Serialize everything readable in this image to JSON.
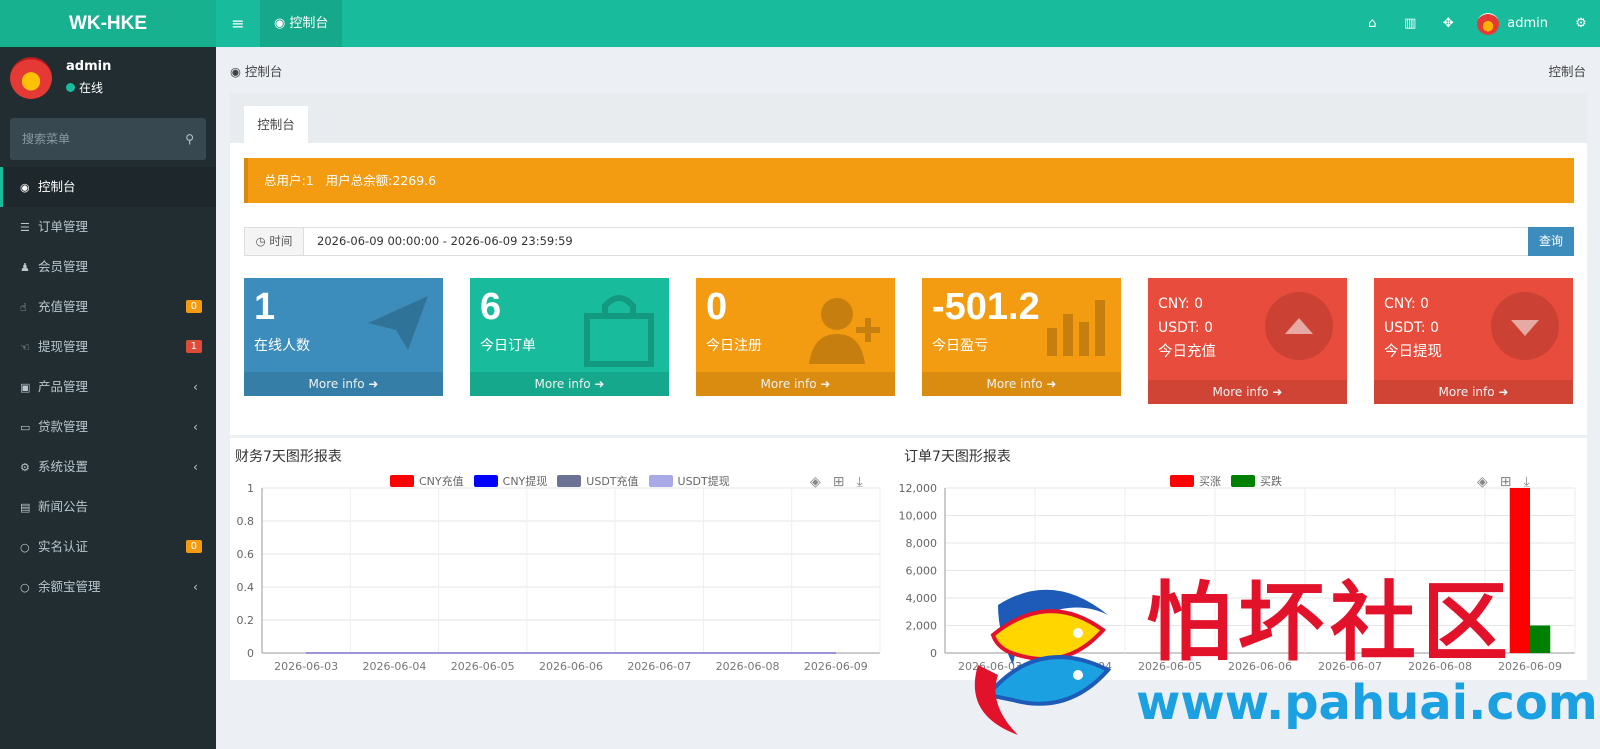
{
  "app": {
    "logo": "WK-HKE"
  },
  "topbar": {
    "menu_icon": "≡",
    "tab_icon": "gauge-icon",
    "tab_label": "控制台",
    "home_icon": "home-icon",
    "trash_icon": "trash-icon",
    "fullscreen_icon": "expand-icon",
    "user_name": "admin",
    "settings_icon": "cogs-icon"
  },
  "sidebar": {
    "user_name": "admin",
    "status": "在线",
    "search_placeholder": "搜索菜单",
    "items": [
      {
        "label": "控制台",
        "icon": "gauge-icon",
        "glyph": "◉",
        "active": true
      },
      {
        "label": "订单管理",
        "icon": "list-icon",
        "glyph": "☰"
      },
      {
        "label": "会员管理",
        "icon": "users-icon",
        "glyph": "♟"
      },
      {
        "label": "充值管理",
        "icon": "hand-icon",
        "glyph": "☝",
        "badge": "0",
        "badge_color": "#f39c12"
      },
      {
        "label": "提现管理",
        "icon": "hand-left-icon",
        "glyph": "☜",
        "badge": "1",
        "badge_color": "#dd4b39"
      },
      {
        "label": "产品管理",
        "icon": "briefcase-icon",
        "glyph": "▣",
        "chevron": "‹"
      },
      {
        "label": "贷款管理",
        "icon": "credit-card-icon",
        "glyph": "▭",
        "chevron": "‹"
      },
      {
        "label": "系统设置",
        "icon": "cogs-icon",
        "glyph": "⚙",
        "chevron": "‹"
      },
      {
        "label": "新闻公告",
        "icon": "newspaper-icon",
        "glyph": "▤"
      },
      {
        "label": "实名认证",
        "icon": "circle-icon",
        "glyph": "○",
        "badge": "0",
        "badge_color": "#f39c12"
      },
      {
        "label": "余额宝管理",
        "icon": "circle-icon",
        "glyph": "○",
        "chevron": "‹"
      }
    ]
  },
  "breadcrumb": {
    "left": "控制台",
    "right": "控制台"
  },
  "content": {
    "tab": "控制台",
    "alert": {
      "users": "总用户:1",
      "balance": "用户总余额:2269.6"
    },
    "time_filter": {
      "label": "时间",
      "value": "2026-06-09 00:00:00 - 2026-06-09 23:59:59",
      "button": "查询"
    },
    "stats": [
      {
        "value": "1",
        "label": "在线人数",
        "footer": "More info ➜",
        "color": "#3c8dbc",
        "icon": "paper-plane-icon"
      },
      {
        "value": "6",
        "label": "今日订单",
        "footer": "More info ➜",
        "color": "#18bc9c",
        "icon": "shopping-bag-icon"
      },
      {
        "value": "0",
        "label": "今日注册",
        "footer": "More info ➜",
        "color": "#f39c12",
        "icon": "user-plus-icon"
      },
      {
        "value": "-501.2",
        "label": "今日盈亏",
        "footer": "More info ➜",
        "color": "#f39c12",
        "icon": "bar-chart-icon"
      },
      {
        "line1": "CNY:  0",
        "line2": "USDT:  0",
        "label": "今日充值",
        "footer": "More info ➜",
        "color": "#e74c3c",
        "icon": "arrow-up-circle-icon"
      },
      {
        "line1": "CNY:  0",
        "line2": "USDT:  0",
        "label": "今日提现",
        "footer": "More info ➜",
        "color": "#e74c3c",
        "icon": "arrow-down-circle-icon"
      }
    ]
  },
  "watermark": {
    "text": "怕坏社区",
    "url": "www.pahuai.com"
  },
  "chart_data": [
    {
      "type": "line",
      "title": "财务7天图形报表",
      "categories": [
        "2026-06-03",
        "2026-06-04",
        "2026-06-05",
        "2026-06-06",
        "2026-06-07",
        "2026-06-08",
        "2026-06-09"
      ],
      "series": [
        {
          "name": "CNY充值",
          "color": "#ff0000",
          "values": [
            0,
            0,
            0,
            0,
            0,
            0,
            0
          ]
        },
        {
          "name": "CNY提现",
          "color": "#0000ff",
          "values": [
            0,
            0,
            0,
            0,
            0,
            0,
            0
          ]
        },
        {
          "name": "USDT充值",
          "color": "#6c7294",
          "values": [
            0,
            0,
            0,
            0,
            0,
            0,
            0
          ]
        },
        {
          "name": "USDT提现",
          "color": "#a9a9e8",
          "values": [
            0,
            0,
            0,
            0,
            0,
            0,
            0
          ]
        }
      ],
      "yticks": [
        "0",
        "0.2",
        "0.4",
        "0.6",
        "0.8",
        "1"
      ],
      "ylim": [
        0,
        1
      ],
      "legend": "top-center",
      "grid": true
    },
    {
      "type": "bar",
      "title": "订单7天图形报表",
      "categories": [
        "2026-06-03",
        "2026-06-04",
        "2026-06-05",
        "2026-06-06",
        "2026-06-07",
        "2026-06-08",
        "2026-06-09"
      ],
      "series": [
        {
          "name": "买涨",
          "color": "#ff0000",
          "values": [
            0,
            0,
            0,
            0,
            0,
            0,
            12000
          ]
        },
        {
          "name": "买跌",
          "color": "#008000",
          "values": [
            0,
            0,
            0,
            0,
            0,
            0,
            2000
          ]
        }
      ],
      "yticks": [
        "0",
        "2,000",
        "4,000",
        "6,000",
        "8,000",
        "10,000",
        "12,000"
      ],
      "ylim": [
        0,
        12000
      ],
      "legend": "top-center",
      "grid": true
    }
  ]
}
